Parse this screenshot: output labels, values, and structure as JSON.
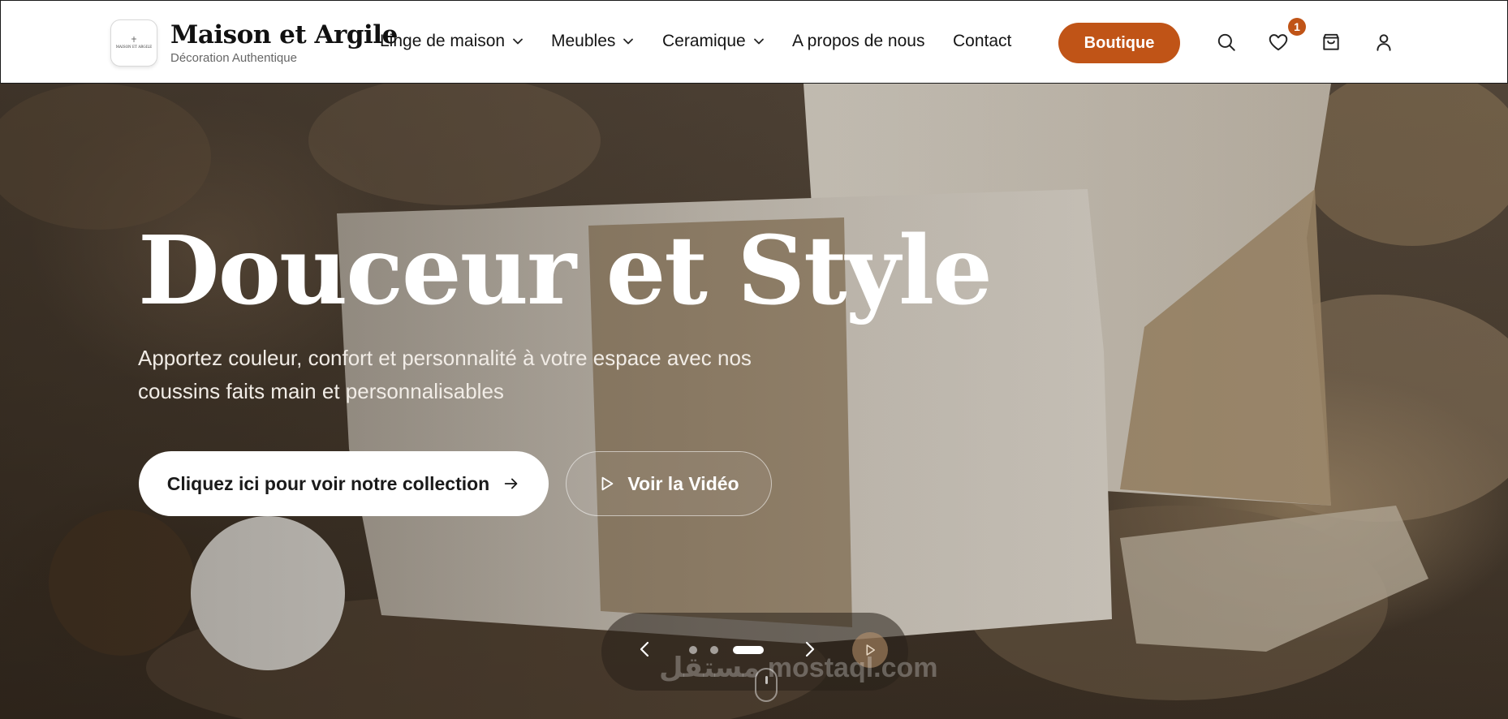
{
  "brand": {
    "name": "Maison et Argile",
    "tagline": "Décoration Authentique",
    "logo_text": "MAISON ET ARGILE"
  },
  "nav": {
    "items": [
      {
        "label": "Linge de maison",
        "has_dropdown": true
      },
      {
        "label": "Meubles",
        "has_dropdown": true
      },
      {
        "label": "Ceramique",
        "has_dropdown": true
      },
      {
        "label": "A propos de nous",
        "has_dropdown": false
      },
      {
        "label": "Contact",
        "has_dropdown": false
      }
    ],
    "cta_label": "Boutique"
  },
  "header_icons": {
    "search": "search-icon",
    "wishlist": "heart-icon",
    "wishlist_count": "1",
    "cart": "shopping-bag-icon",
    "account": "user-icon"
  },
  "hero": {
    "title": "Douceur et Style",
    "subtitle": "Apportez couleur, confort et personnalité à votre espace avec nos coussins faits main et personnalisables",
    "primary_button": "Cliquez ici pour voir notre collection",
    "secondary_button": "Voir la Vidéo"
  },
  "slider": {
    "total_slides": 3,
    "active_slide": 3
  },
  "watermark": "مستقل mostaql.com",
  "colors": {
    "accent": "#c05417",
    "header_bg": "#ffffff",
    "text_dark": "#151515",
    "hero_text": "#ffffff"
  }
}
